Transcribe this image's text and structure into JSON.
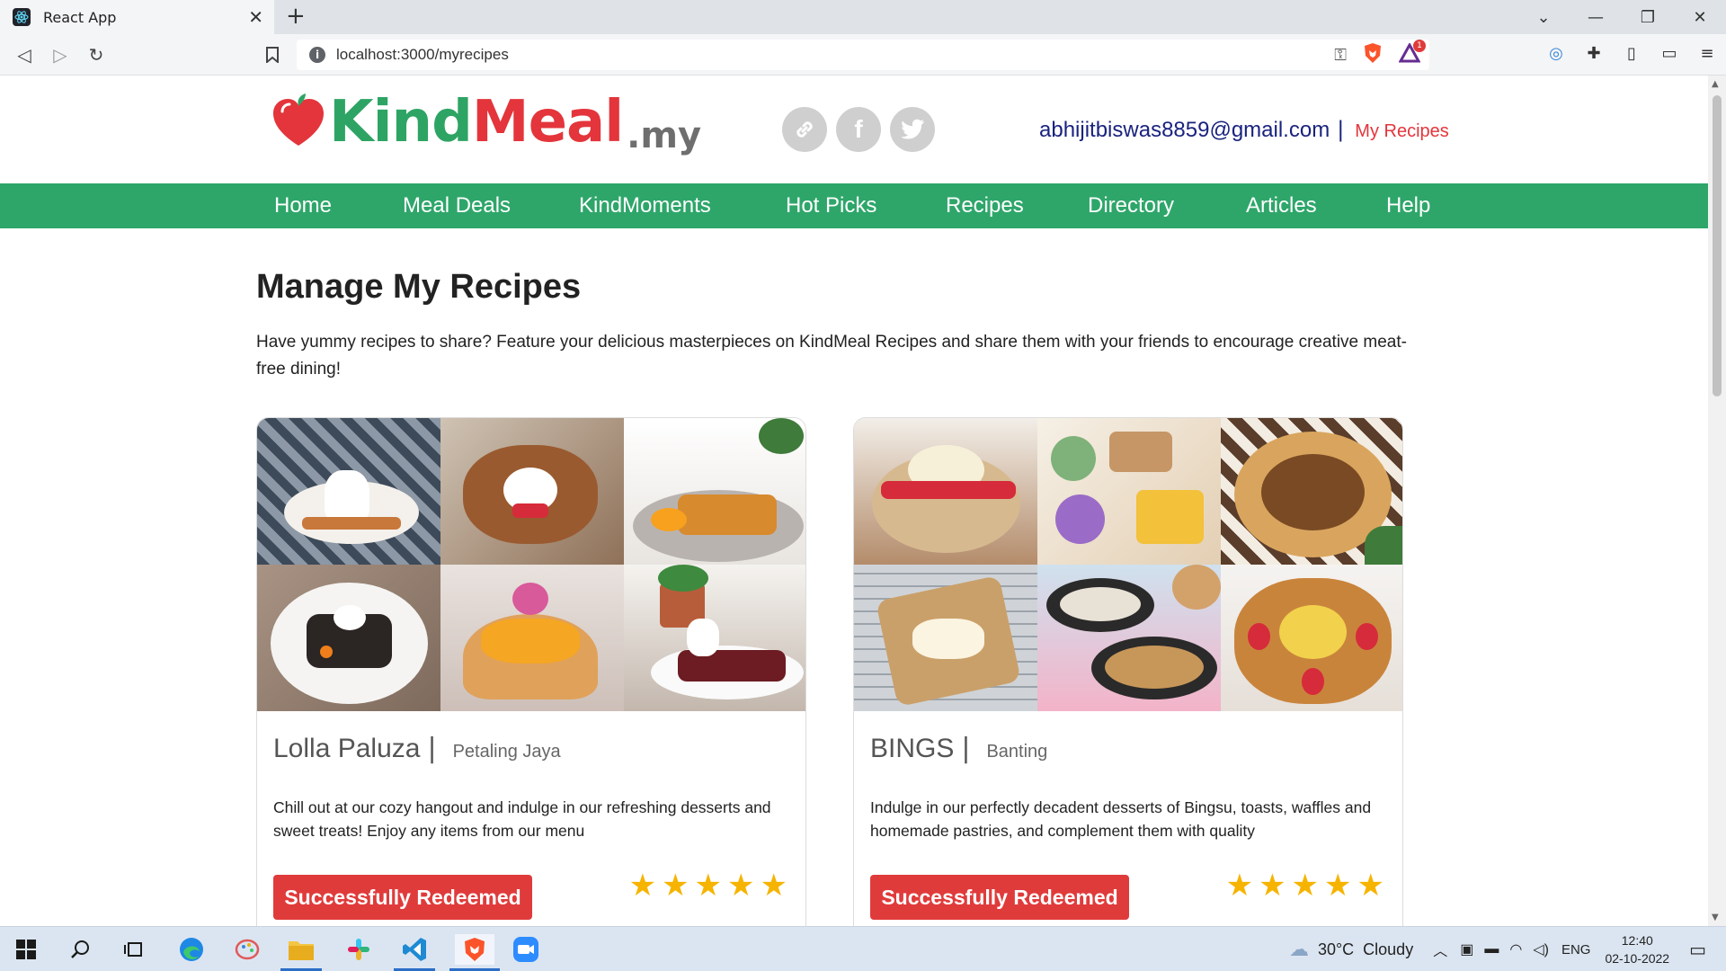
{
  "browser": {
    "tab_title": "React App",
    "url": "localhost:3000/myrecipes",
    "notification_count": "1"
  },
  "site": {
    "logo": {
      "kind": "Kind",
      "meal": "Meal",
      "suffix": ".my"
    },
    "social_icons": [
      "link-icon",
      "facebook-icon",
      "twitter-icon"
    ],
    "user_email": "abhijitbiswas8859@gmail.com",
    "separator": "|",
    "my_recipes_link": "My Recipes",
    "nav": [
      "Home",
      "Meal Deals",
      "KindMoments",
      "Hot Picks",
      "Recipes",
      "Directory",
      "Articles",
      "Help"
    ],
    "colors": {
      "brand_green": "#2ea66a",
      "brand_red": "#e3353b",
      "star": "#f6b400",
      "button_red": "#e03b3b"
    }
  },
  "main": {
    "title": "Manage My Recipes",
    "intro": "Have yummy recipes to share? Feature your delicious masterpieces on KindMeal Recipes and share them with your friends to encourage creative meat-free dining!",
    "cards": [
      {
        "name": "Lolla Paluza",
        "separator": "|",
        "location": "Petaling Jaya",
        "description": "Chill out at our cozy hangout and indulge in our refreshing desserts and sweet treats! Enjoy any items from our menu",
        "button": "Successfully Redeemed",
        "stars": "★★★★★",
        "rating": 5
      },
      {
        "name": "BINGS",
        "separator": "|",
        "location": "Banting",
        "description": "Indulge in our perfectly decadent desserts of Bingsu, toasts, waffles and homemade pastries, and complement them with quality",
        "button": "Successfully Redeemed",
        "stars": "★★★★★",
        "rating": 5
      }
    ]
  },
  "taskbar": {
    "weather": "30°C  Cloudy",
    "language": "ENG",
    "time": "12:40",
    "date": "02-10-2022"
  }
}
